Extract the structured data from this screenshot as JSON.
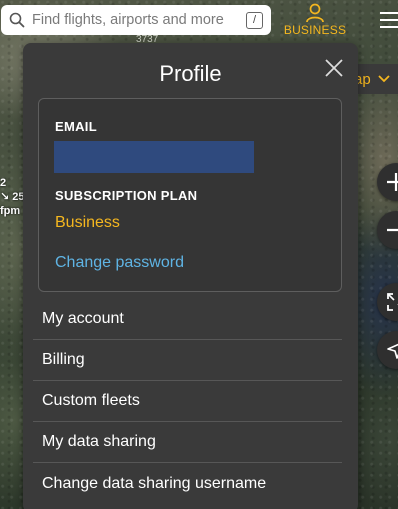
{
  "search": {
    "placeholder": "Find flights, airports and more",
    "shortcut_key": "/"
  },
  "header": {
    "business_label": "BUSINESS"
  },
  "map": {
    "label_3737": "3737",
    "flight_info_lines": [
      "2",
      "↘ 25",
      "fpm"
    ],
    "map_type_label": "ap"
  },
  "profile": {
    "title": "Profile",
    "email_label": "EMAIL",
    "subscription_label": "SUBSCRIPTION PLAN",
    "subscription_value": "Business",
    "change_password": "Change password",
    "menu_items": [
      "My account",
      "Billing",
      "Custom fleets",
      "My data sharing",
      "Change data sharing username"
    ]
  },
  "colors": {
    "accent": "#f5b71f",
    "link": "#5fb4e4",
    "panel_bg": "#3a3a3a",
    "redaction": "#2f4a7e"
  }
}
